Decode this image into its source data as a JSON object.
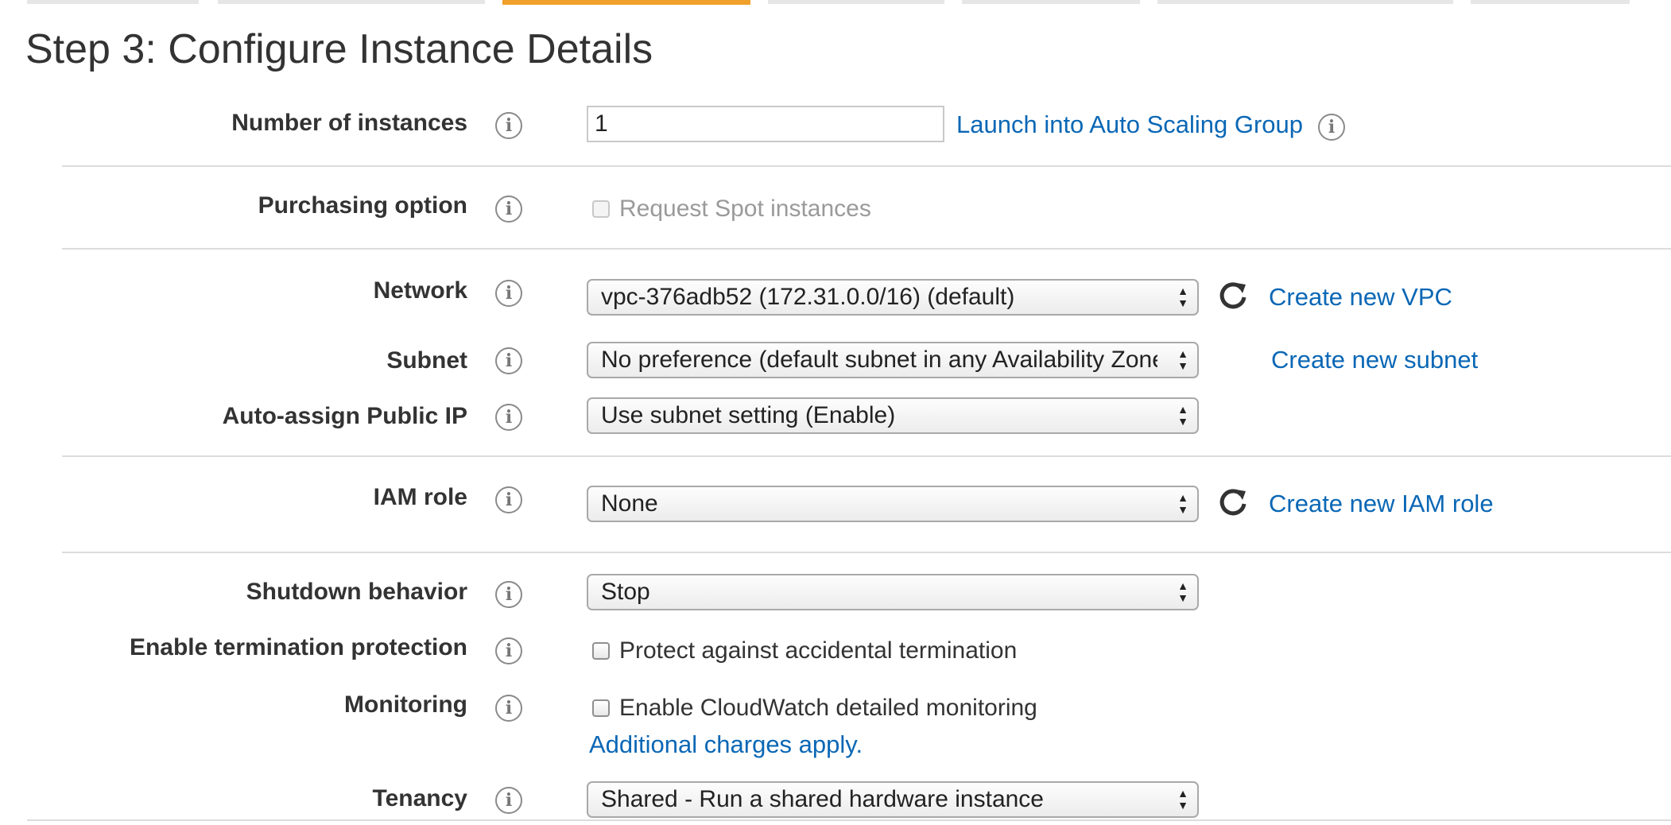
{
  "title": "Step 3: Configure Instance Details",
  "colors": {
    "link": "#0a67b5",
    "active_step": "#f0a02b",
    "label": "#333333"
  },
  "fields": {
    "instances": {
      "label": "Number of instances",
      "value": "1",
      "link": "Launch into Auto Scaling Group"
    },
    "purchasing": {
      "label": "Purchasing option",
      "checkbox_label": "Request Spot instances",
      "checked": false
    },
    "network": {
      "label": "Network",
      "selected": "vpc-376adb52 (172.31.0.0/16) (default)",
      "link": "Create new VPC"
    },
    "subnet": {
      "label": "Subnet",
      "selected": "No preference (default subnet in any Availability Zone)",
      "link": "Create new subnet"
    },
    "public_ip": {
      "label": "Auto-assign Public IP",
      "selected": "Use subnet setting (Enable)"
    },
    "iam": {
      "label": "IAM role",
      "selected": "None",
      "link": "Create new IAM role"
    },
    "shutdown": {
      "label": "Shutdown behavior",
      "selected": "Stop"
    },
    "termination": {
      "label": "Enable termination protection",
      "checkbox_label": "Protect against accidental termination",
      "checked": false
    },
    "monitoring": {
      "label": "Monitoring",
      "checkbox_label": "Enable CloudWatch detailed monitoring",
      "checked": false,
      "link": "Additional charges apply."
    },
    "tenancy": {
      "label": "Tenancy",
      "selected": "Shared - Run a shared hardware instance"
    }
  },
  "icons": {
    "info": "info-icon",
    "refresh": "refresh-icon",
    "select_arrows": "select-arrows-icon"
  }
}
